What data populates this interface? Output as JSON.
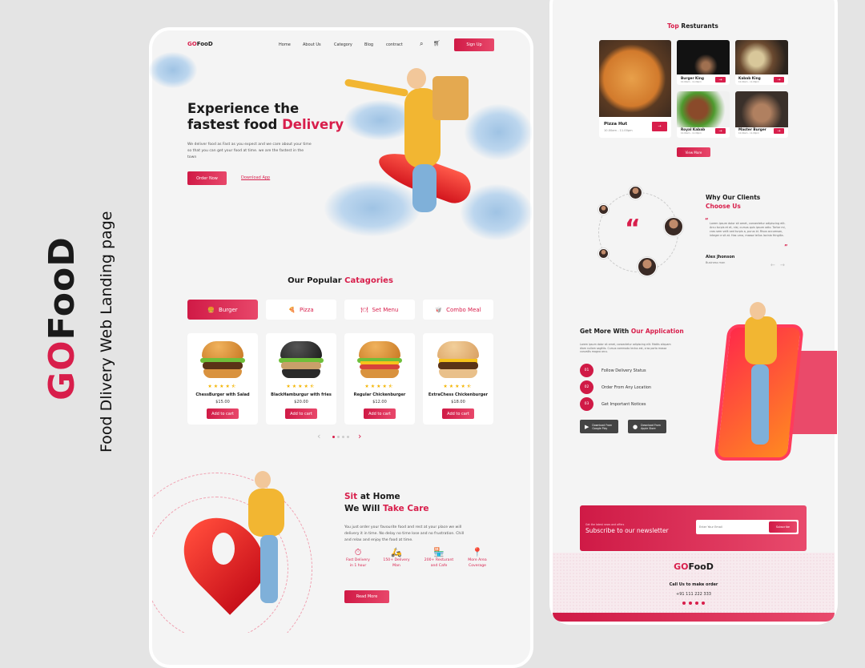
{
  "side": {
    "logo_go": "GO",
    "logo_food": "FooD",
    "subtitle": "Food Dlivery Web Landing page"
  },
  "colors": {
    "accent": "#d81e4b",
    "background": "#e4e4e4",
    "card": "#f4f4f4"
  },
  "nav": {
    "logo_go": "GO",
    "logo_food": "FooD",
    "links": [
      "Home",
      "About Us",
      "Category",
      "Blog",
      "contract"
    ],
    "search_icon": "search-icon",
    "cart_icon": "cart-icon",
    "signup": "Sign Up"
  },
  "hero": {
    "title_line1": "Experience the",
    "title_line2": "fastest food ",
    "title_highlight": "Delivery",
    "description": "We deliver food as Fast as you expect and we care about your time so that you can get your food at time. we are the fastest in the town",
    "order_button": "Order Now",
    "download_link": "Download App"
  },
  "categories": {
    "title": "Our Popular ",
    "title_highlight": "Catagories",
    "tabs": [
      {
        "label": "Burger",
        "icon": "🍔",
        "active": true
      },
      {
        "label": "Pizza",
        "icon": "🍕"
      },
      {
        "label": "Set Menu",
        "icon": "🍽"
      },
      {
        "label": "Combo Meal",
        "icon": "🥡"
      }
    ]
  },
  "products": [
    {
      "name": "ChessBurger with Salad",
      "price": "$15.00",
      "rating": 4.5,
      "button": "Add to cart"
    },
    {
      "name": "BlackHamburgur with fries",
      "price": "$20.00",
      "rating": 4.5,
      "button": "Add to cart"
    },
    {
      "name": "Regular Chickenburger",
      "price": "$12.00",
      "rating": 4.5,
      "button": "Add to cart"
    },
    {
      "name": "ExtraChess Chickenburger",
      "price": "$18.00",
      "rating": 4.5,
      "button": "Add to cart"
    }
  ],
  "pagination": {
    "prev": "‹",
    "next": "›",
    "pages": 4,
    "current": 1
  },
  "care": {
    "title1_highlight": "Sit",
    "title1": " at Home",
    "title2": "We Will ",
    "title2_highlight": "Take Care",
    "description": "You just order your favourite food and rest at your place we will delivery it in time. No delay no time lose and no frustration. Chill and relax and enjoy the food at time.",
    "features": [
      {
        "line1": "Fast Delivery",
        "line2": "in 1 hour",
        "icon": "⏱"
      },
      {
        "line1": "150+ Delivery",
        "line2": "Man",
        "icon": "🛵"
      },
      {
        "line1": "200+ Resturant",
        "line2": "and Cafe",
        "icon": "🏪"
      },
      {
        "line1": "More Area",
        "line2": "Coverage",
        "icon": "📍"
      }
    ],
    "button": "Read More"
  },
  "restaurants": {
    "title_highlight": "Top",
    "title": " Resturants",
    "items": [
      {
        "name": "Pizza Hut",
        "hours": "10.00am - 11.00pm"
      },
      {
        "name": "Burger King",
        "hours": "10.00am - 11.00pm"
      },
      {
        "name": "Kabab King",
        "hours": "10.00am - 11.00pm"
      },
      {
        "name": "Royal Kabab",
        "hours": "10.00am - 11.00pm"
      },
      {
        "name": "Master Burger",
        "hours": "10.00am - 11.00pm"
      }
    ],
    "button": "View More"
  },
  "testimonial": {
    "title": "Why Our Clients",
    "title_highlight": "Choose Us",
    "quote": "Lorem ipsum dolor sit amet, consectetur adipiscing elit. Arcu turpis et et, nisi, cursus quis ipsum odio. Tortor mi, cras sem velit sed turpis a, purus id. Risus accumsan, integer e sit at. Has urna, massa tellus lacinia fringilla.",
    "name": "Alex Jhonson",
    "role": "Business man",
    "prev": "←",
    "next": "→"
  },
  "app": {
    "title": "Get More With ",
    "title_highlight": "Our Application",
    "description": "Lorem ipsum dolor sit amet, consectetur adipiscing elit. Mattis aliquam diam nullam sagittis. Cursus commodo lectus est, cras porta massa convallis magna arcu.",
    "steps": [
      {
        "num": "01",
        "label": "Follow Delivery Status"
      },
      {
        "num": "02",
        "label": "Order From Any Location"
      },
      {
        "num": "03",
        "label": "Get Important Notices"
      }
    ],
    "stores": [
      {
        "small": "Download From",
        "name": "Google Play",
        "icon": "▶"
      },
      {
        "small": "Download From",
        "name": "Apple Store",
        "icon": ""
      }
    ]
  },
  "newsletter": {
    "small": "Get the latest news and offers",
    "title": "Subscribe to our newsletter",
    "placeholder": "Enter Your Email",
    "button": "Subscribe"
  },
  "footer": {
    "logo_go": "GO",
    "logo_food": "FooD",
    "call": "Call Us to make order",
    "phone": "+91 111 222 333",
    "socials": [
      "facebook",
      "twitter",
      "instagram",
      "linkedin"
    ]
  }
}
